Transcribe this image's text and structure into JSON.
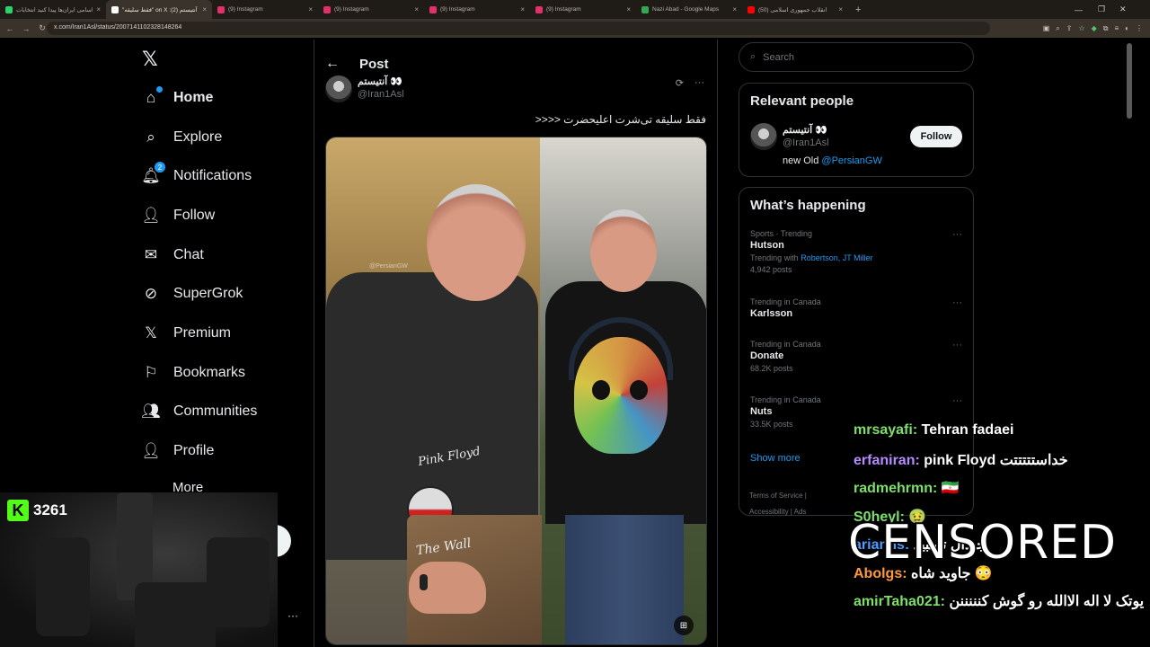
{
  "browser": {
    "tabs": [
      {
        "title": "اسامی ایران‌ها پیدا کنید انتخابات",
        "fav": "#2bd36b",
        "active": false
      },
      {
        "title": "\"فقط سلیقه\" on X :(2) آنتیستم 👀",
        "fav": "#ffffff",
        "active": true
      },
      {
        "title": "(9) Instagram",
        "fav": "#e1306c",
        "active": false
      },
      {
        "title": "(9) Instagram",
        "fav": "#e1306c",
        "active": false
      },
      {
        "title": "(9) Instagram",
        "fav": "#e1306c",
        "active": false
      },
      {
        "title": "(9) Instagram",
        "fav": "#e1306c",
        "active": false
      },
      {
        "title": "Nazi Abad - Google Maps",
        "fav": "#34a853",
        "active": false
      },
      {
        "title": "انقلاب جمهوری اسلامی (50)",
        "fav": "#ff0000",
        "active": false
      }
    ],
    "url": "x.com/Iran1Asl/status/2007141102328148264"
  },
  "nav": {
    "items": [
      {
        "label": "Home",
        "icon": "home-icon",
        "name": "nav-home"
      },
      {
        "label": "Explore",
        "icon": "search-icon",
        "name": "nav-explore"
      },
      {
        "label": "Notifications",
        "icon": "bell-icon",
        "name": "nav-notifications",
        "badge": "2"
      },
      {
        "label": "Follow",
        "icon": "add-person-icon",
        "name": "nav-follow"
      },
      {
        "label": "Chat",
        "icon": "mail-icon",
        "name": "nav-chat"
      },
      {
        "label": "SuperGrok",
        "icon": "grok-icon",
        "name": "nav-supergrok"
      },
      {
        "label": "Premium",
        "icon": "x-logo-icon",
        "name": "nav-premium"
      },
      {
        "label": "Bookmarks",
        "icon": "bookmark-icon",
        "name": "nav-bookmarks"
      },
      {
        "label": "Communities",
        "icon": "people-icon",
        "name": "nav-communities"
      },
      {
        "label": "Profile",
        "icon": "person-icon",
        "name": "nav-profile"
      },
      {
        "label": "More",
        "icon": "more-circle-icon",
        "name": "nav-more"
      }
    ]
  },
  "post": {
    "header": "Post",
    "author_name": "آنتیستم 👀",
    "author_handle": "@Iran1Asl",
    "text": "فقط سلیقه تی‌شرت اعلیحضرت <<<<",
    "watermark": "@PersianGW",
    "shirt_text_top": "Pink Floyd",
    "shirt_text_bottom": "The Wall"
  },
  "search": {
    "placeholder": "Search"
  },
  "relevant": {
    "title": "Relevant people",
    "name": "آنتیستم 👀",
    "handle": "@Iran1Asl",
    "bio_prefix": "new Old ",
    "bio_link": "@PersianGW",
    "follow_label": "Follow"
  },
  "happening": {
    "title": "What’s happening",
    "trends": [
      {
        "meta": "Sports · Trending",
        "name": "Hutson",
        "sub_prefix": "Trending with ",
        "sub_link": "Robertson, JT Miller",
        "posts": "4,942 posts"
      },
      {
        "meta": "Trending in Canada",
        "name": "Karlsson",
        "posts": ""
      },
      {
        "meta": "Trending in Canada",
        "name": "Donate",
        "posts": "68.2K posts"
      },
      {
        "meta": "Trending in Canada",
        "name": "Nuts",
        "posts": "33.5K posts"
      }
    ],
    "show_more": "Show more"
  },
  "footer": {
    "line1": "Terms of Service  |",
    "line2": "Accessibility  |  Ads"
  },
  "stream": {
    "viewers": "3261",
    "censored": "CENSORED",
    "chat": [
      {
        "user": "mrsayafi:",
        "msg": " Tehran fadaei",
        "color": "#7ee06a"
      },
      {
        "user": "erfaniran:",
        "msg": " pink Floyd خداستتتتتت",
        "color": "#b58cff"
      },
      {
        "user": "radmehrmn:",
        "msg": " 🇮🇷",
        "color": "#7ee06a"
      },
      {
        "user": "S0heyl:",
        "msg": " 🤢",
        "color": "#7ee06a"
      },
      {
        "user": "arianhs:",
        "msg": " جیدال تسبید",
        "color": "#4a9cff"
      },
      {
        "user": "Abolgs:",
        "msg": " جاوید شاه 😳",
        "color": "#ff9a3c"
      },
      {
        "user": "amirTaha021:",
        "msg": " یوتک لا اله الاالله رو گوش کنننننن",
        "color": "#7ee06a"
      }
    ]
  }
}
